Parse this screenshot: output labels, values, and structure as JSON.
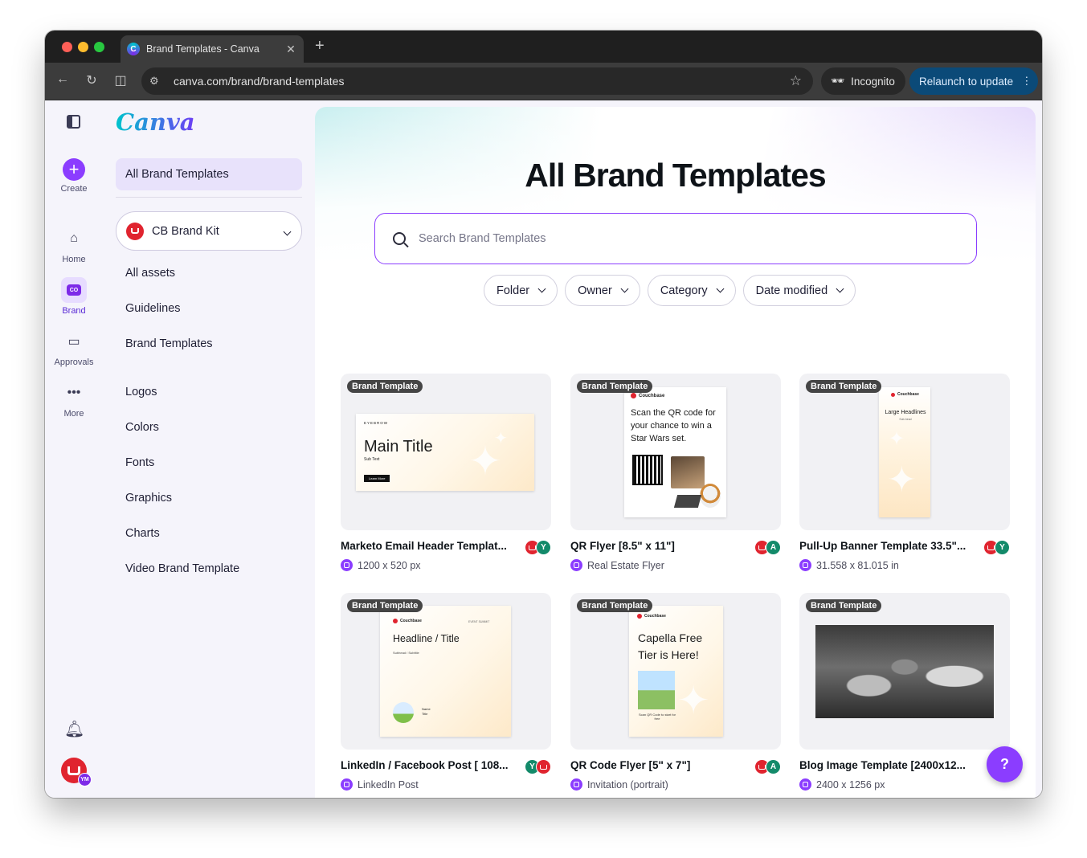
{
  "browser": {
    "tab_title": "Brand Templates - Canva",
    "tab_favicon": "C",
    "url": "canva.com/brand/brand-templates",
    "incognito_label": "Incognito",
    "relaunch_label": "Relaunch to update"
  },
  "rail": {
    "create": "Create",
    "home": "Home",
    "brand": "Brand",
    "brand_chip": "CO",
    "approvals": "Approvals",
    "more": "More",
    "avatar_initials": "YM"
  },
  "sidebar": {
    "logo": "Canva",
    "active_item": "All Brand Templates",
    "brand_kit": "CB Brand Kit",
    "items": [
      "All assets",
      "Guidelines",
      "Brand Templates",
      "Logos",
      "Colors",
      "Fonts",
      "Graphics",
      "Charts",
      "Video Brand Template"
    ]
  },
  "main": {
    "title": "All Brand Templates",
    "search_placeholder": "Search Brand Templates",
    "filters": [
      "Folder",
      "Owner",
      "Category",
      "Date modified"
    ],
    "help_label": "?",
    "cards": [
      {
        "tag": "Brand Template",
        "title": "Marketo Email Header Templat...",
        "meta": "1200 x 520 px",
        "avatars": [
          "cb",
          "Y"
        ]
      },
      {
        "tag": "Brand Template",
        "title": "QR Flyer [8.5\" x 11\"]",
        "meta": "Real Estate Flyer",
        "avatars": [
          "cb",
          "A"
        ]
      },
      {
        "tag": "Brand Template",
        "title": "Pull-Up Banner Template 33.5\"...",
        "meta": "31.558 x 81.015 in",
        "avatars": [
          "cb",
          "Y"
        ]
      },
      {
        "tag": "Brand Template",
        "title": "LinkedIn / Facebook Post [ 108...",
        "meta": "LinkedIn Post",
        "avatars": [
          "Y",
          "cb"
        ]
      },
      {
        "tag": "Brand Template",
        "title": "QR Code Flyer [5\" x 7\"]",
        "meta": "Invitation (portrait)",
        "avatars": [
          "cb",
          "A"
        ]
      },
      {
        "tag": "Brand Template",
        "title": "Blog Image Template [2400x12...",
        "meta": "2400 x 1256 px",
        "avatars": [
          "cb"
        ]
      }
    ],
    "thumbs": {
      "t1": {
        "eyebrow": "EYEBROW",
        "title": "Main Title",
        "sub": "Sub Text",
        "button": "Learn More"
      },
      "t2": {
        "brand": "Couchbase",
        "text": "Scan the QR code for your chance to win a Star Wars set."
      },
      "t3": {
        "brand": "Couchbase",
        "title": "Large Headlines",
        "sub": "Sub-head"
      },
      "t4": {
        "brand": "Couchbase",
        "event": "EVENT SUMMIT",
        "title": "Headline / Title",
        "sub": "Subhead / Subtitle",
        "name": "Name",
        "role": "Title"
      },
      "t5": {
        "brand": "Couchbase",
        "title": "Capella Free Tier is Here!",
        "cta": "Scan QR Code to start for free"
      }
    }
  },
  "colors": {
    "accent": "#8b3dff",
    "couchbase_red": "#e0242f"
  }
}
